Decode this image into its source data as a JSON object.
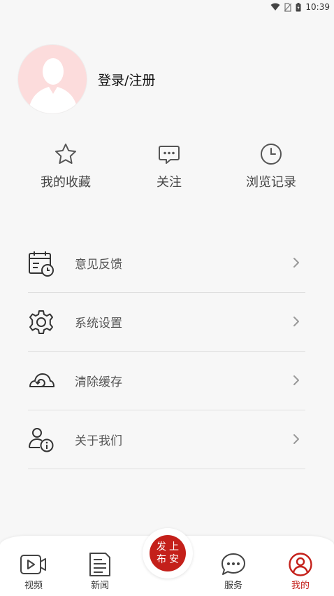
{
  "status_bar": {
    "time": "10:39"
  },
  "profile": {
    "login_label": "登录/注册"
  },
  "quick_actions": [
    {
      "label": "我的收藏",
      "icon": "star-icon"
    },
    {
      "label": "关注",
      "icon": "chat-dots-icon"
    },
    {
      "label": "浏览记录",
      "icon": "clock-icon"
    }
  ],
  "menu": [
    {
      "label": "意见反馈",
      "icon": "calendar-clock-icon"
    },
    {
      "label": "系统设置",
      "icon": "gear-icon"
    },
    {
      "label": "清除缓存",
      "icon": "cloud-refresh-icon"
    },
    {
      "label": "关于我们",
      "icon": "user-info-icon"
    }
  ],
  "tabbar": {
    "items": [
      {
        "label": "视频",
        "icon": "video-icon",
        "active": false
      },
      {
        "label": "新闻",
        "icon": "news-icon",
        "active": false
      },
      {
        "label": "服务",
        "icon": "chat-icon",
        "active": false
      },
      {
        "label": "我的",
        "icon": "profile-icon",
        "active": true
      }
    ],
    "center_seal": [
      "发",
      "上",
      "布",
      "安"
    ]
  },
  "colors": {
    "accent": "#c4201a",
    "background": "#f7f7f7"
  }
}
